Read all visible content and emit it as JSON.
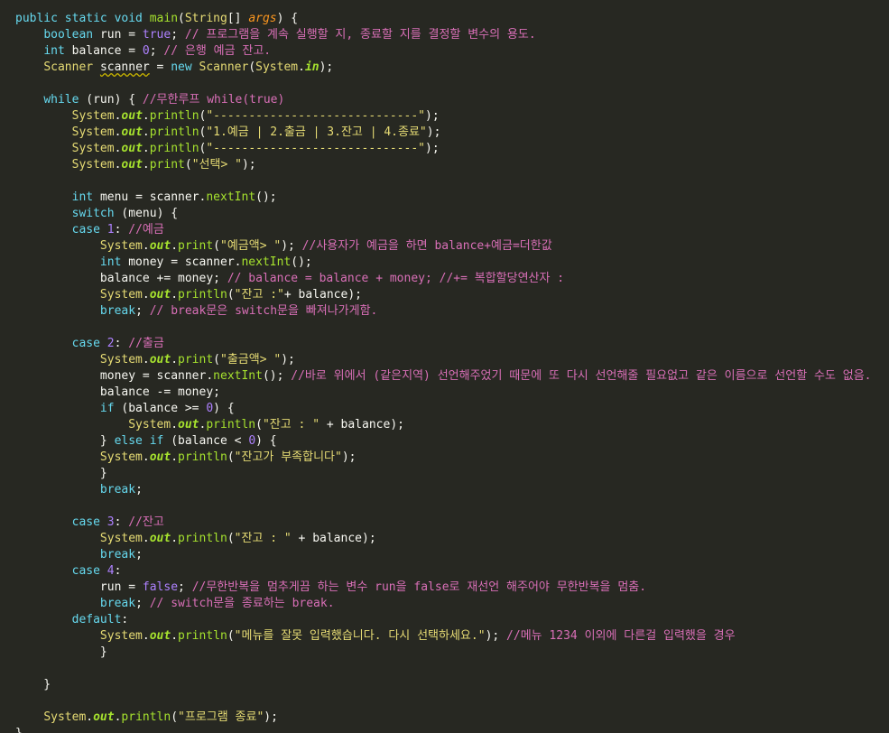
{
  "editor": {
    "lines": [
      [
        [
          "kw",
          "public static void "
        ],
        [
          "fn",
          "main"
        ],
        [
          "op",
          "("
        ],
        [
          "type",
          "String"
        ],
        [
          "op",
          "[] "
        ],
        [
          "param",
          "args"
        ],
        [
          "op",
          ") {"
        ]
      ],
      [
        [
          "op",
          "    "
        ],
        [
          "kw",
          "boolean "
        ],
        [
          "var",
          "run "
        ],
        [
          "op",
          "= "
        ],
        [
          "bool",
          "true"
        ],
        [
          "op",
          "; "
        ],
        [
          "cmt",
          "// 프로그램을 계속 실행할 지, 종료할 지를 결정할 변수의 용도."
        ]
      ],
      [
        [
          "op",
          "    "
        ],
        [
          "kw",
          "int "
        ],
        [
          "var",
          "balance "
        ],
        [
          "op",
          "= "
        ],
        [
          "num",
          "0"
        ],
        [
          "op",
          "; "
        ],
        [
          "cmt",
          "// 은행 예금 잔고."
        ]
      ],
      [
        [
          "op",
          "    "
        ],
        [
          "type",
          "Scanner "
        ],
        [
          "warn",
          "scanner"
        ],
        [
          "op",
          " = "
        ],
        [
          "kw",
          "new "
        ],
        [
          "type",
          "Scanner"
        ],
        [
          "op",
          "("
        ],
        [
          "type",
          "System"
        ],
        [
          "op",
          "."
        ],
        [
          "field",
          "in"
        ],
        [
          "op",
          ");"
        ]
      ],
      [],
      [
        [
          "op",
          "    "
        ],
        [
          "kw",
          "while "
        ],
        [
          "op",
          "("
        ],
        [
          "var",
          "run"
        ],
        [
          "op",
          ") { "
        ],
        [
          "cmt",
          "//무한루프 while(true)"
        ]
      ],
      [
        [
          "op",
          "        "
        ],
        [
          "type",
          "System"
        ],
        [
          "op",
          "."
        ],
        [
          "field",
          "out"
        ],
        [
          "op",
          "."
        ],
        [
          "fn",
          "println"
        ],
        [
          "op",
          "("
        ],
        [
          "str",
          "\"-----------------------------\""
        ],
        [
          "op",
          ");"
        ]
      ],
      [
        [
          "op",
          "        "
        ],
        [
          "type",
          "System"
        ],
        [
          "op",
          "."
        ],
        [
          "field",
          "out"
        ],
        [
          "op",
          "."
        ],
        [
          "fn",
          "println"
        ],
        [
          "op",
          "("
        ],
        [
          "str",
          "\"1.예금 | 2.출금 | 3.잔고 | 4.종료\""
        ],
        [
          "op",
          ");"
        ]
      ],
      [
        [
          "op",
          "        "
        ],
        [
          "type",
          "System"
        ],
        [
          "op",
          "."
        ],
        [
          "field",
          "out"
        ],
        [
          "op",
          "."
        ],
        [
          "fn",
          "println"
        ],
        [
          "op",
          "("
        ],
        [
          "str",
          "\"-----------------------------\""
        ],
        [
          "op",
          ");"
        ]
      ],
      [
        [
          "op",
          "        "
        ],
        [
          "type",
          "System"
        ],
        [
          "op",
          "."
        ],
        [
          "field",
          "out"
        ],
        [
          "op",
          "."
        ],
        [
          "fn",
          "print"
        ],
        [
          "op",
          "("
        ],
        [
          "str",
          "\"선택> \""
        ],
        [
          "op",
          ");"
        ]
      ],
      [],
      [
        [
          "op",
          "        "
        ],
        [
          "kw",
          "int "
        ],
        [
          "var",
          "menu "
        ],
        [
          "op",
          "= "
        ],
        [
          "var",
          "scanner"
        ],
        [
          "op",
          "."
        ],
        [
          "fn",
          "nextInt"
        ],
        [
          "op",
          "();"
        ]
      ],
      [
        [
          "op",
          "        "
        ],
        [
          "kw",
          "switch "
        ],
        [
          "op",
          "("
        ],
        [
          "var",
          "menu"
        ],
        [
          "op",
          ") {"
        ]
      ],
      [
        [
          "op",
          "        "
        ],
        [
          "kw",
          "case "
        ],
        [
          "num",
          "1"
        ],
        [
          "op",
          ": "
        ],
        [
          "cmt",
          "//예금"
        ]
      ],
      [
        [
          "op",
          "            "
        ],
        [
          "type",
          "System"
        ],
        [
          "op",
          "."
        ],
        [
          "field",
          "out"
        ],
        [
          "op",
          "."
        ],
        [
          "fn",
          "print"
        ],
        [
          "op",
          "("
        ],
        [
          "str",
          "\"예금액> \""
        ],
        [
          "op",
          "); "
        ],
        [
          "cmt",
          "//사용자가 예금을 하면 balance+예금=더한값"
        ]
      ],
      [
        [
          "op",
          "            "
        ],
        [
          "kw",
          "int "
        ],
        [
          "var",
          "money "
        ],
        [
          "op",
          "= "
        ],
        [
          "var",
          "scanner"
        ],
        [
          "op",
          "."
        ],
        [
          "fn",
          "nextInt"
        ],
        [
          "op",
          "();"
        ]
      ],
      [
        [
          "op",
          "            "
        ],
        [
          "var",
          "balance "
        ],
        [
          "op",
          "+= "
        ],
        [
          "var",
          "money"
        ],
        [
          "op",
          "; "
        ],
        [
          "cmt",
          "// balance = balance + money; //+= 복합할당연산자 :"
        ]
      ],
      [
        [
          "op",
          "            "
        ],
        [
          "type",
          "System"
        ],
        [
          "op",
          "."
        ],
        [
          "field",
          "out"
        ],
        [
          "op",
          "."
        ],
        [
          "fn",
          "println"
        ],
        [
          "op",
          "("
        ],
        [
          "str",
          "\"잔고 :\""
        ],
        [
          "op",
          "+ "
        ],
        [
          "var",
          "balance"
        ],
        [
          "op",
          ");"
        ]
      ],
      [
        [
          "op",
          "            "
        ],
        [
          "kw",
          "break"
        ],
        [
          "op",
          "; "
        ],
        [
          "cmt",
          "// break문은 switch문을 빠져나가게함."
        ]
      ],
      [],
      [
        [
          "op",
          "        "
        ],
        [
          "kw",
          "case "
        ],
        [
          "num",
          "2"
        ],
        [
          "op",
          ": "
        ],
        [
          "cmt",
          "//출금"
        ]
      ],
      [
        [
          "op",
          "            "
        ],
        [
          "type",
          "System"
        ],
        [
          "op",
          "."
        ],
        [
          "field",
          "out"
        ],
        [
          "op",
          "."
        ],
        [
          "fn",
          "print"
        ],
        [
          "op",
          "("
        ],
        [
          "str",
          "\"출금액> \""
        ],
        [
          "op",
          ");"
        ]
      ],
      [
        [
          "op",
          "            "
        ],
        [
          "var",
          "money "
        ],
        [
          "op",
          "= "
        ],
        [
          "var",
          "scanner"
        ],
        [
          "op",
          "."
        ],
        [
          "fn",
          "nextInt"
        ],
        [
          "op",
          "(); "
        ],
        [
          "cmt",
          "//바로 위에서 (같은지역) 선언해주었기 때문에 또 다시 선언해줄 필요없고 같은 이름으로 선언할 수도 없음."
        ]
      ],
      [
        [
          "op",
          "            "
        ],
        [
          "var",
          "balance "
        ],
        [
          "op",
          "-= "
        ],
        [
          "var",
          "money"
        ],
        [
          "op",
          ";"
        ]
      ],
      [
        [
          "op",
          "            "
        ],
        [
          "kw",
          "if "
        ],
        [
          "op",
          "("
        ],
        [
          "var",
          "balance "
        ],
        [
          "op",
          ">= "
        ],
        [
          "num",
          "0"
        ],
        [
          "op",
          ") {"
        ]
      ],
      [
        [
          "op",
          "                "
        ],
        [
          "type",
          "System"
        ],
        [
          "op",
          "."
        ],
        [
          "field",
          "out"
        ],
        [
          "op",
          "."
        ],
        [
          "fn",
          "println"
        ],
        [
          "op",
          "("
        ],
        [
          "str",
          "\"잔고 : \""
        ],
        [
          "op",
          " + "
        ],
        [
          "var",
          "balance"
        ],
        [
          "op",
          ");"
        ]
      ],
      [
        [
          "op",
          "            } "
        ],
        [
          "kw",
          "else if "
        ],
        [
          "op",
          "("
        ],
        [
          "var",
          "balance "
        ],
        [
          "op",
          "< "
        ],
        [
          "num",
          "0"
        ],
        [
          "op",
          ") {"
        ]
      ],
      [
        [
          "op",
          "            "
        ],
        [
          "type",
          "System"
        ],
        [
          "op",
          "."
        ],
        [
          "field",
          "out"
        ],
        [
          "op",
          "."
        ],
        [
          "fn",
          "println"
        ],
        [
          "op",
          "("
        ],
        [
          "str",
          "\"잔고가 부족합니다\""
        ],
        [
          "op",
          ");"
        ]
      ],
      [
        [
          "op",
          "            }"
        ]
      ],
      [
        [
          "op",
          "            "
        ],
        [
          "kw",
          "break"
        ],
        [
          "op",
          ";"
        ]
      ],
      [],
      [
        [
          "op",
          "        "
        ],
        [
          "kw",
          "case "
        ],
        [
          "num",
          "3"
        ],
        [
          "op",
          ": "
        ],
        [
          "cmt",
          "//잔고"
        ]
      ],
      [
        [
          "op",
          "            "
        ],
        [
          "type",
          "System"
        ],
        [
          "op",
          "."
        ],
        [
          "field",
          "out"
        ],
        [
          "op",
          "."
        ],
        [
          "fn",
          "println"
        ],
        [
          "op",
          "("
        ],
        [
          "str",
          "\"잔고 : \""
        ],
        [
          "op",
          " + "
        ],
        [
          "var",
          "balance"
        ],
        [
          "op",
          ");"
        ]
      ],
      [
        [
          "op",
          "            "
        ],
        [
          "kw",
          "break"
        ],
        [
          "op",
          ";"
        ]
      ],
      [
        [
          "op",
          "        "
        ],
        [
          "kw",
          "case "
        ],
        [
          "num",
          "4"
        ],
        [
          "op",
          ":"
        ]
      ],
      [
        [
          "op",
          "            "
        ],
        [
          "var",
          "run "
        ],
        [
          "op",
          "= "
        ],
        [
          "bool",
          "false"
        ],
        [
          "op",
          "; "
        ],
        [
          "cmt",
          "//무한반복을 멈추게끔 하는 변수 run을 false로 재선언 해주어야 무한반복을 멈춤."
        ]
      ],
      [
        [
          "op",
          "            "
        ],
        [
          "kw",
          "break"
        ],
        [
          "op",
          "; "
        ],
        [
          "cmt",
          "// switch문을 종료하는 break."
        ]
      ],
      [
        [
          "op",
          "        "
        ],
        [
          "kw",
          "default"
        ],
        [
          "op",
          ":"
        ]
      ],
      [
        [
          "op",
          "            "
        ],
        [
          "type",
          "System"
        ],
        [
          "op",
          "."
        ],
        [
          "field",
          "out"
        ],
        [
          "op",
          "."
        ],
        [
          "fn",
          "println"
        ],
        [
          "op",
          "("
        ],
        [
          "str",
          "\"메뉴를 잘못 입력했습니다. 다시 선택하세요.\""
        ],
        [
          "op",
          "); "
        ],
        [
          "cmt",
          "//메뉴 1234 이외에 다른걸 입력했을 경우"
        ]
      ],
      [
        [
          "op",
          "            }"
        ]
      ],
      [],
      [
        [
          "op",
          "    }"
        ]
      ],
      [],
      [
        [
          "op",
          "    "
        ],
        [
          "type",
          "System"
        ],
        [
          "op",
          "."
        ],
        [
          "field",
          "out"
        ],
        [
          "op",
          "."
        ],
        [
          "fn",
          "println"
        ],
        [
          "op",
          "("
        ],
        [
          "str",
          "\"프로그램 종료\""
        ],
        [
          "op",
          ");"
        ]
      ],
      [
        [
          "op",
          "}"
        ]
      ]
    ]
  }
}
